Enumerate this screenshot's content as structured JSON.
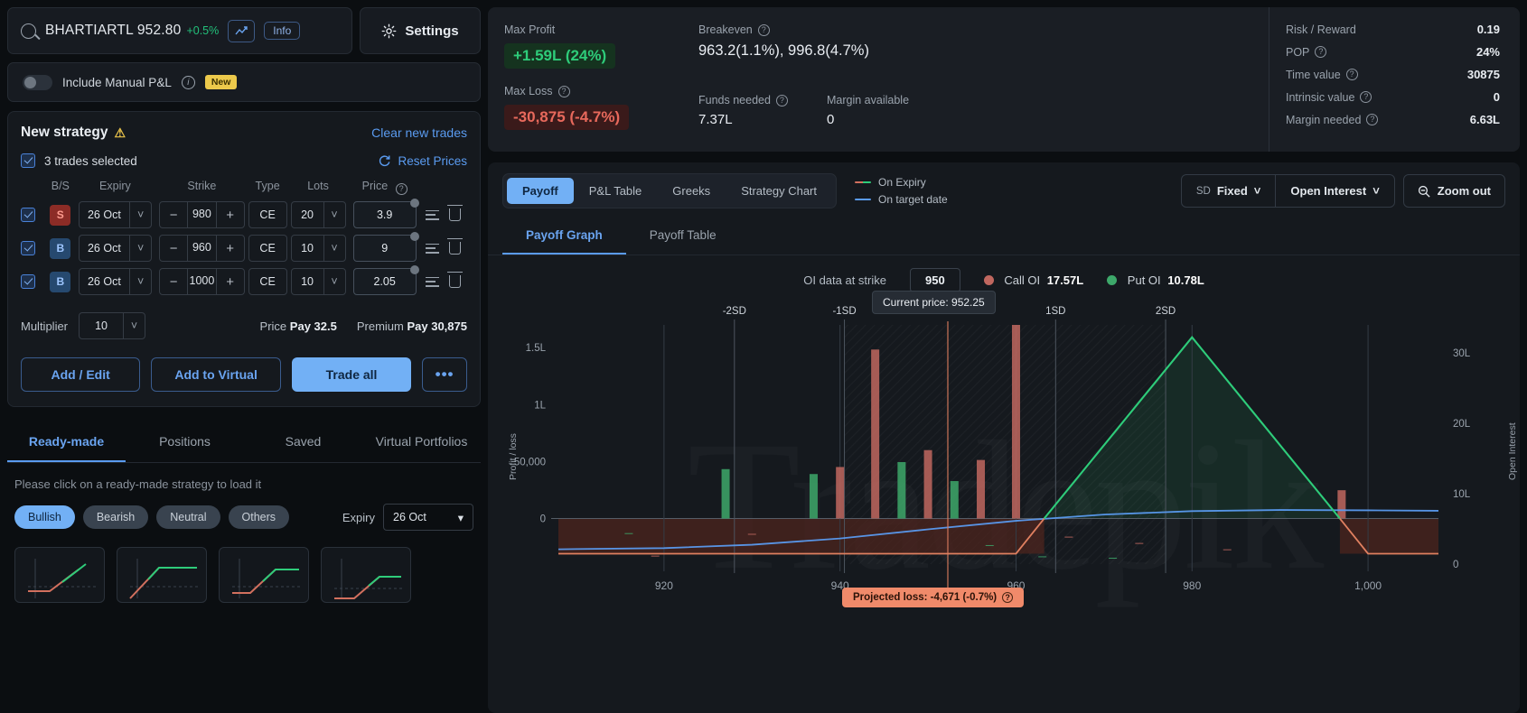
{
  "search": {
    "symbol": "BHARTIARTL 952.80",
    "change": "+0.5%",
    "info_label": "Info",
    "chart_icon": "trend-up-icon"
  },
  "settings": {
    "label": "Settings",
    "icon": "gear-icon"
  },
  "manual_pnl": {
    "label": "Include Manual P&L",
    "badge": "New",
    "toggle_state": "off"
  },
  "strategy": {
    "title": "New strategy",
    "clear_label": "Clear new trades",
    "selected_label": "3 trades selected",
    "reset_label": "Reset Prices",
    "columns": [
      "B/S",
      "Expiry",
      "Strike",
      "Type",
      "Lots",
      "Price"
    ],
    "rows": [
      {
        "bs": "S",
        "bs_kind": "sell",
        "expiry": "26 Oct",
        "strike": "980",
        "type": "CE",
        "lots": "20",
        "price": "3.9"
      },
      {
        "bs": "B",
        "bs_kind": "buy",
        "expiry": "26 Oct",
        "strike": "960",
        "type": "CE",
        "lots": "10",
        "price": "9"
      },
      {
        "bs": "B",
        "bs_kind": "buy",
        "expiry": "26 Oct",
        "strike": "1000",
        "type": "CE",
        "lots": "10",
        "price": "2.05"
      }
    ],
    "multiplier_label": "Multiplier",
    "multiplier_value": "10",
    "price_label": "Price",
    "price_value": "Pay 32.5",
    "premium_label": "Premium",
    "premium_value": "Pay 30,875",
    "buttons": {
      "add_edit": "Add / Edit",
      "add_virtual": "Add to Virtual",
      "trade_all": "Trade all",
      "more": "•••"
    }
  },
  "lower_tabs": [
    {
      "label": "Ready-made",
      "active": true
    },
    {
      "label": "Positions",
      "active": false
    },
    {
      "label": "Saved",
      "active": false
    },
    {
      "label": "Virtual Portfolios",
      "active": false
    }
  ],
  "ready_made": {
    "hint": "Please click on a ready-made strategy to load it",
    "chips": [
      {
        "label": "Bullish",
        "active": true
      },
      {
        "label": "Bearish",
        "active": false
      },
      {
        "label": "Neutral",
        "active": false
      },
      {
        "label": "Others",
        "active": false
      }
    ],
    "expiry_label": "Expiry",
    "expiry_value": "26 Oct"
  },
  "stats": {
    "max_profit_label": "Max Profit",
    "max_profit_value": "+1.59L (24%)",
    "max_loss_label": "Max Loss",
    "max_loss_value": "-30,875 (-4.7%)",
    "breakeven_label": "Breakeven",
    "breakeven_value": "963.2(1.1%),  996.8(4.7%)",
    "funds_label": "Funds needed",
    "funds_value": "7.37L",
    "margin_label": "Margin available",
    "margin_value": "0",
    "metrics": [
      {
        "key": "Risk / Reward",
        "value": "0.19",
        "has_help": false
      },
      {
        "key": "POP",
        "value": "24%",
        "has_help": true
      },
      {
        "key": "Time value",
        "value": "30875",
        "has_help": true
      },
      {
        "key": "Intrinsic value",
        "value": "0",
        "has_help": true
      },
      {
        "key": "Margin needed",
        "value": "6.63L",
        "has_help": true
      }
    ]
  },
  "chart_tabs": [
    {
      "label": "Payoff",
      "active": true
    },
    {
      "label": "P&L Table",
      "active": false
    },
    {
      "label": "Greeks",
      "active": false
    },
    {
      "label": "Strategy Chart",
      "active": false
    }
  ],
  "chart_legend": [
    {
      "label": "On Expiry",
      "color": "#2ecc7a"
    },
    {
      "label": "On target date",
      "color": "#5a9bf0"
    }
  ],
  "chart_controls": {
    "sd_prefix": "SD",
    "sd_value": "Fixed",
    "oi_value": "Open Interest",
    "zoom_out": "Zoom out",
    "chevron": "chevron-down-icon",
    "zoom_icon": "zoom-out-icon"
  },
  "sub_tabs": [
    {
      "label": "Payoff Graph",
      "active": true
    },
    {
      "label": "Payoff Table",
      "active": false
    }
  ],
  "oi_bar": {
    "at_strike_label": "OI data at strike",
    "at_strike_value": "950",
    "call_label": "Call OI",
    "call_value": "17.57L",
    "call_color": "#c0675f",
    "put_label": "Put OI",
    "put_value": "10.78L",
    "put_color": "#3da86a"
  },
  "annotations": {
    "current_price": "Current price: 952.25",
    "projected_loss": "Projected loss: -4,671 (-0.7%)"
  },
  "chart_data": {
    "type": "line",
    "title": "Payoff Graph",
    "xlabel": "",
    "ylabel": "Profit / loss",
    "y2label": "Open Interest",
    "x_ticks": [
      "920",
      "940",
      "960",
      "980",
      "1,000"
    ],
    "x_tick_values": [
      920,
      940,
      960,
      980,
      1000
    ],
    "y_ticks": [
      "0",
      "50,000",
      "1L",
      "1.5L"
    ],
    "y_tick_values": [
      0,
      50000,
      100000,
      150000
    ],
    "y2_ticks": [
      "0",
      "10L",
      "20L",
      "30L"
    ],
    "y2_tick_values": [
      0,
      1000000,
      2000000,
      3000000
    ],
    "xlim": [
      908,
      1008
    ],
    "ylim": [
      -40000,
      170000
    ],
    "y2lim": [
      0,
      3400000
    ],
    "sd_lines": [
      {
        "label": "-2SD",
        "x": 928
      },
      {
        "label": "-1SD",
        "x": 940.5
      },
      {
        "label": "1SD",
        "x": 964.5
      },
      {
        "label": "2SD",
        "x": 977
      }
    ],
    "current_price_x": 952.25,
    "breakevens": [
      963.2,
      996.8
    ],
    "series": [
      {
        "name": "On Expiry",
        "color": "#2ecc7a",
        "points": [
          [
            908,
            -30875
          ],
          [
            960,
            -30875
          ],
          [
            980,
            159125
          ],
          [
            1000,
            -30875
          ],
          [
            1008,
            -30875
          ]
        ]
      },
      {
        "name": "On target date",
        "color": "#5a9bf0",
        "points": [
          [
            908,
            -27000
          ],
          [
            920,
            -26000
          ],
          [
            930,
            -23000
          ],
          [
            940,
            -17500
          ],
          [
            950,
            -9500
          ],
          [
            960,
            -2000
          ],
          [
            970,
            3500
          ],
          [
            980,
            6500
          ],
          [
            990,
            7500
          ],
          [
            1000,
            7200
          ],
          [
            1008,
            6800
          ]
        ]
      }
    ],
    "call_oi_bars": [
      {
        "x": 919,
        "value": 120000
      },
      {
        "x": 930,
        "value": 430000
      },
      {
        "x": 940,
        "value": 1380000
      },
      {
        "x": 944,
        "value": 3050000
      },
      {
        "x": 950,
        "value": 1620000
      },
      {
        "x": 956,
        "value": 1480000
      },
      {
        "x": 960,
        "value": 3400000
      },
      {
        "x": 966,
        "value": 390000
      },
      {
        "x": 974,
        "value": 300000
      },
      {
        "x": 984,
        "value": 210000
      },
      {
        "x": 997,
        "value": 1050000
      }
    ],
    "put_oi_bars": [
      {
        "x": 916,
        "value": 440000
      },
      {
        "x": 927,
        "value": 1350000
      },
      {
        "x": 937,
        "value": 1280000
      },
      {
        "x": 947,
        "value": 1450000
      },
      {
        "x": 953,
        "value": 1180000
      },
      {
        "x": 957,
        "value": 270000
      },
      {
        "x": 963,
        "value": 110000
      },
      {
        "x": 971,
        "value": 90000
      }
    ]
  }
}
